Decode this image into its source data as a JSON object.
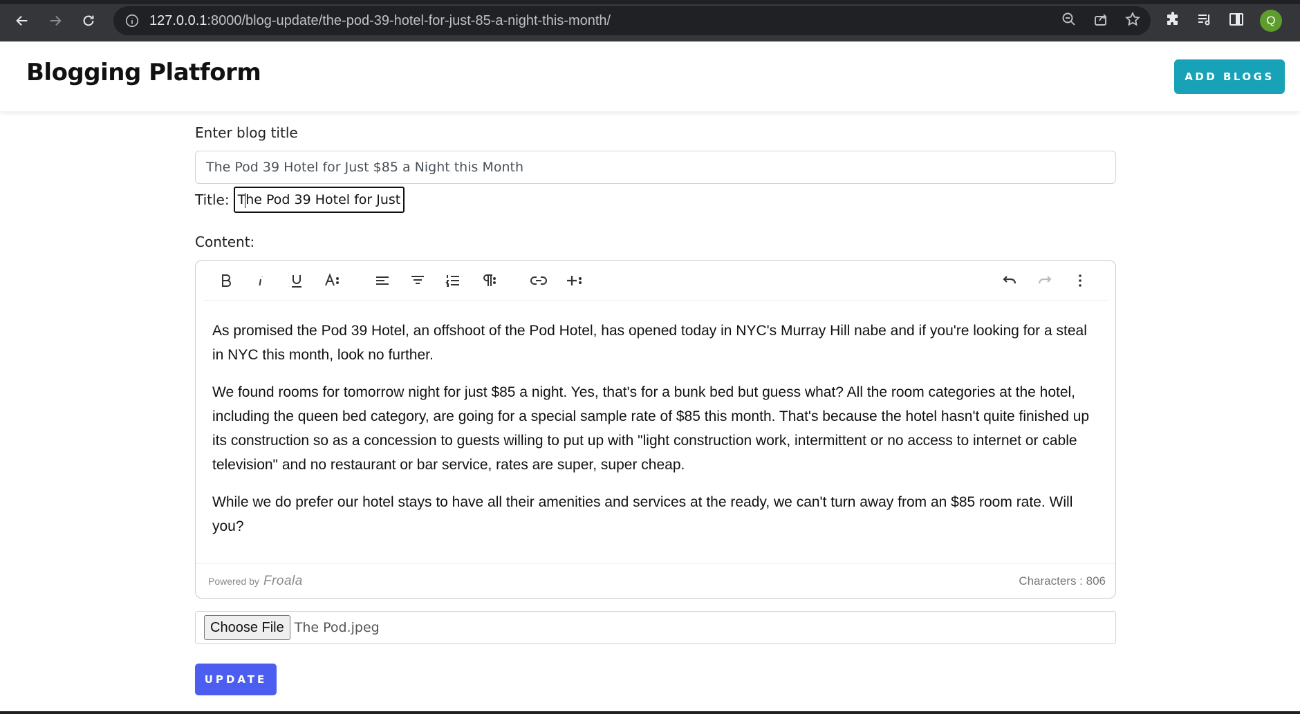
{
  "browser": {
    "url_host": "127.0.0.1",
    "url_rest": ":8000/blog-update/the-pod-39-hotel-for-just-85-a-night-this-month/",
    "profile_initial": "Q"
  },
  "header": {
    "brand": "Blogging Platform",
    "add_button": "ADD BLOGS"
  },
  "form": {
    "title_label": "Enter blog title",
    "title_value": "The Pod 39 Hotel for Just $85 a Night this Month",
    "title_preview_label": "Title:",
    "title_preview_value": "The Pod 39 Hotel for Just",
    "content_label": "Content:",
    "editor": {
      "paragraphs": [
        "As promised the Pod 39 Hotel, an offshoot of the Pod Hotel, has opened today in NYC's Murray Hill nabe and if you're looking for a steal in NYC this month, look no further.",
        "We found rooms for tomorrow night for just $85 a night. Yes, that's for a bunk bed but guess what? All the room categories at the hotel, including the queen bed category, are going for a special sample rate of $85 this month. That's because the hotel hasn't quite finished up its construction so as a concession to guests willing to put up with \"light construction work, intermittent or no access to internet or cable television\" and no restaurant or bar service, rates are super, super cheap.",
        "While we do prefer our hotel stays to have all their amenities and services at the ready, we can't turn away from an $85 room rate. Will you?"
      ],
      "powered_by": "Powered by",
      "powered_brand": "Froala",
      "char_count": "Characters : 806",
      "toolbar": [
        "bold-icon",
        "italic-icon",
        "underline-icon",
        "font-size-icon",
        "align-left-icon",
        "align-center-icon",
        "ordered-list-icon",
        "paragraph-format-icon",
        "link-icon",
        "insert-more-icon",
        "undo-icon",
        "redo-icon",
        "more-options-icon"
      ]
    },
    "file_button": "Choose File",
    "file_name": "The Pod.jpeg",
    "update_button": "UPDATE"
  },
  "colors": {
    "add_button": "#17a2b8",
    "update_button": "#4c5ef0",
    "avatar": "#5e9c2e"
  }
}
